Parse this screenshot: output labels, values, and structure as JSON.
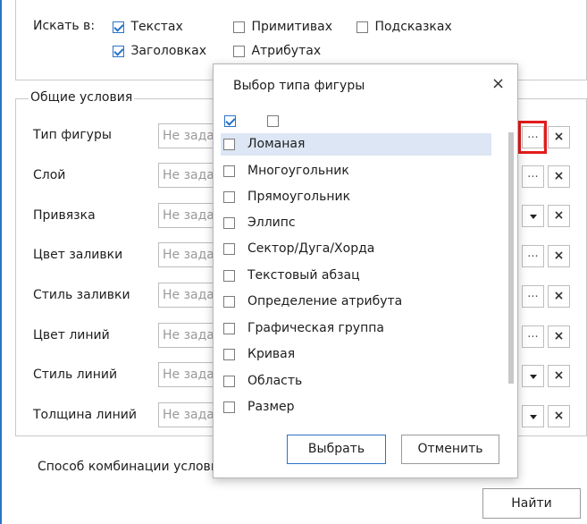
{
  "search_in": {
    "label": "Искать в:",
    "options": [
      {
        "label": "Текстах",
        "checked": true
      },
      {
        "label": "Примитивах",
        "checked": false
      },
      {
        "label": "Подсказках",
        "checked": false
      },
      {
        "label": "Заголовках",
        "checked": true
      },
      {
        "label": "Атрибутах",
        "checked": false
      }
    ]
  },
  "general": {
    "title": "Общие условия",
    "placeholder": "Не задано",
    "rows": [
      {
        "label": "Тип фигуры",
        "button": "dots"
      },
      {
        "label": "Слой",
        "button": "dots"
      },
      {
        "label": "Привязка",
        "button": "dropdown"
      },
      {
        "label": "Цвет заливки",
        "button": "dots"
      },
      {
        "label": "Стиль заливки",
        "button": "dots"
      },
      {
        "label": "Цвет линий",
        "button": "dots"
      },
      {
        "label": "Стиль линий",
        "button": "dropdown"
      },
      {
        "label": "Толщина линий",
        "button": "dropdown"
      }
    ],
    "dots_label": "...",
    "clear_label": "×"
  },
  "combine_label": "Способ комбинации условий",
  "find_button": "Найти",
  "dialog": {
    "title": "Выбор типа фигуры",
    "close": "×",
    "header_checks": [
      true,
      false
    ],
    "items": [
      {
        "label": "Ломаная",
        "checked": false,
        "selected": true
      },
      {
        "label": "Многоугольник",
        "checked": false
      },
      {
        "label": "Прямоугольник",
        "checked": false
      },
      {
        "label": "Эллипс",
        "checked": false
      },
      {
        "label": "Сектор/Дуга/Хорда",
        "checked": false
      },
      {
        "label": "Текстовый абзац",
        "checked": false
      },
      {
        "label": "Определение атрибута",
        "checked": false
      },
      {
        "label": "Графическая группа",
        "checked": false
      },
      {
        "label": "Кривая",
        "checked": false
      },
      {
        "label": "Область",
        "checked": false
      },
      {
        "label": "Размер",
        "checked": false
      }
    ],
    "ok_button": "Выбрать",
    "cancel_button": "Отменить"
  },
  "colors": {
    "accent": "#2a73c8",
    "highlight": "#e31b1b",
    "selected_row": "#dce6f4"
  }
}
